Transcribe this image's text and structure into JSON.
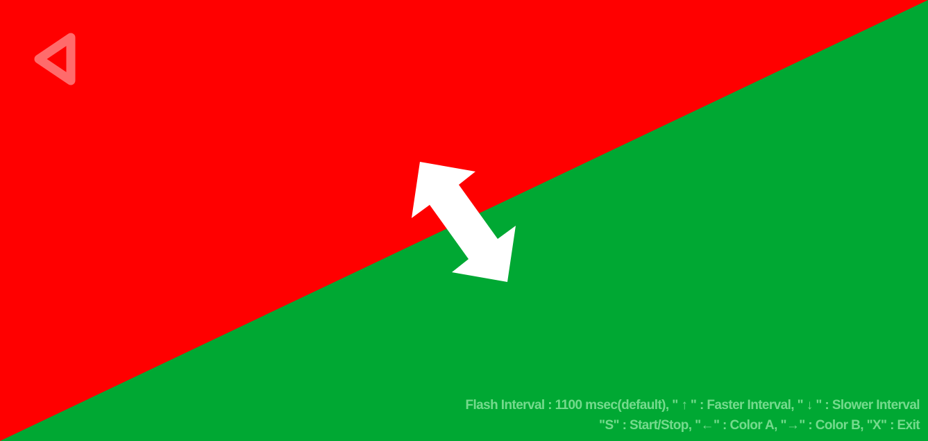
{
  "colors": {
    "color_a": "#ff0000",
    "color_b": "#00a833",
    "back_icon": "#ff6b6b",
    "arrow": "#ffffff",
    "help_text": "#c8ffcd"
  },
  "icons": {
    "back": "back-triangle-icon",
    "swap": "double-arrow-icon"
  },
  "help": {
    "line1": "Flash Interval : 1100 msec(default), \" ↑ \" : Faster Interval, \" ↓ \" : Slower Interval",
    "line2": "\"S\" : Start/Stop, \"←\" : Color A, \"→\" : Color B, \"X\" : Exit"
  }
}
